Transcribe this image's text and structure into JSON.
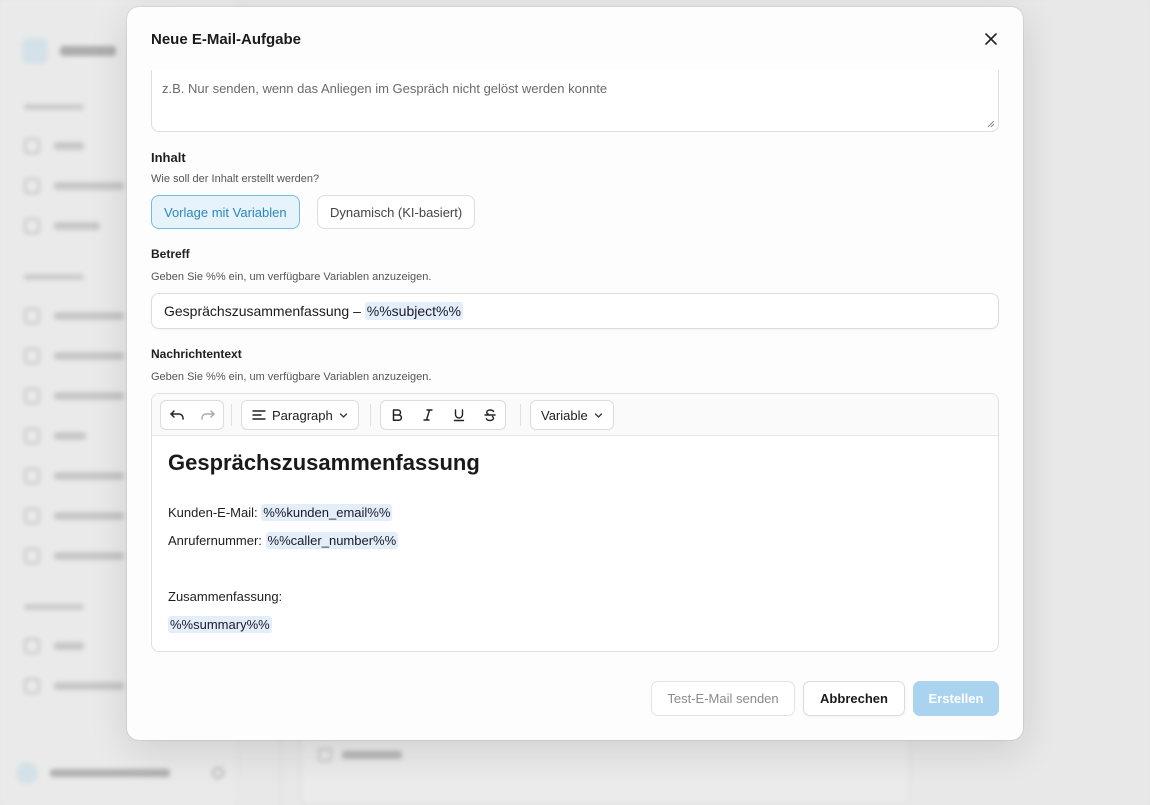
{
  "modal": {
    "title": "Neue E-Mail-Aufgabe",
    "close_icon": "close-icon",
    "condition_placeholder": "z.B. Nur senden, wenn das Anliegen im Gespräch nicht gelöst werden konnte"
  },
  "content": {
    "label": "Inhalt",
    "help": "Wie soll der Inhalt erstellt werden?",
    "options": [
      {
        "label": "Vorlage mit Variablen",
        "selected": true
      },
      {
        "label": "Dynamisch (KI-basiert)",
        "selected": false
      }
    ]
  },
  "subject": {
    "label": "Betreff",
    "help": "Geben Sie %% ein, um verfügbare Variablen anzuzeigen.",
    "text": "Gesprächszusammenfassung – ",
    "variable": "%%subject%%"
  },
  "message": {
    "label": "Nachrichtentext",
    "help": "Geben Sie %% ein, um verfügbare Variablen anzuzeigen.",
    "toolbar": {
      "undo_icon": "undo-icon",
      "redo_icon": "redo-icon",
      "paragraph_label": "Paragraph",
      "bold_icon": "bold-icon",
      "italic_icon": "italic-icon",
      "underline_icon": "underline-icon",
      "strike_icon": "strikethrough-icon",
      "variable_label": "Variable"
    },
    "body": {
      "heading": "Gesprächszusammenfassung",
      "email_label": "Kunden-E-Mail: ",
      "email_var": "%%kunden_email%%",
      "caller_label": "Anrufernummer: ",
      "caller_var": "%%caller_number%%",
      "summary_label": "Zusammenfassung:",
      "summary_var": "%%summary%%"
    }
  },
  "footer": {
    "test_label": "Test-E-Mail senden",
    "cancel_label": "Abbrechen",
    "create_label": "Erstellen"
  },
  "colors": {
    "accent": "#2a87bc",
    "accent_bg": "#e6f3fa",
    "variable_bg": "#e3eef9",
    "create_disabled": "#a9d3ef"
  }
}
